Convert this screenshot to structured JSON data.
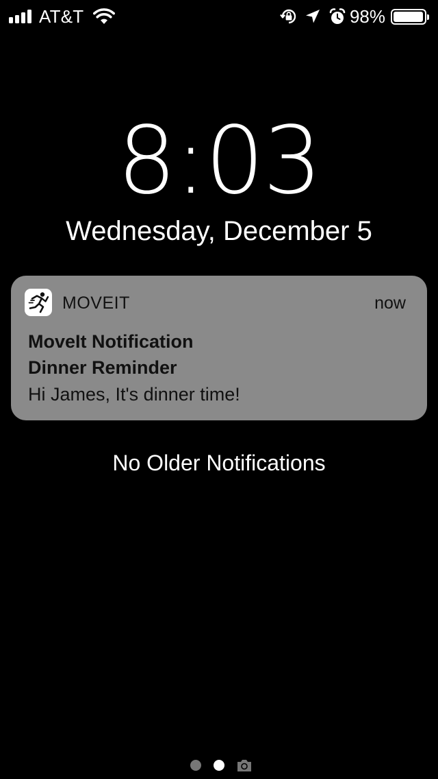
{
  "status_bar": {
    "carrier": "AT&T",
    "battery_percent": "98%",
    "battery_level": 0.98,
    "icons": [
      "signal-bars-icon",
      "wifi-icon",
      "orientation-lock-icon",
      "location-arrow-icon",
      "alarm-clock-icon",
      "battery-icon"
    ]
  },
  "lock_screen": {
    "time": "8:03",
    "date": "Wednesday, December 5"
  },
  "notification": {
    "app_icon": "running-figure-icon",
    "app_name": "MOVEIT",
    "time": "now",
    "title": "MoveIt Notification",
    "subtitle": "Dinner Reminder",
    "body": "Hi James, It's dinner time!"
  },
  "footer": {
    "no_older_text": "No Older Notifications",
    "page_count": 2,
    "current_page": 2,
    "camera_icon": "camera-icon"
  },
  "colors": {
    "background": "#000000",
    "notification_bg": "#8a8a8a",
    "text": "#ffffff"
  }
}
